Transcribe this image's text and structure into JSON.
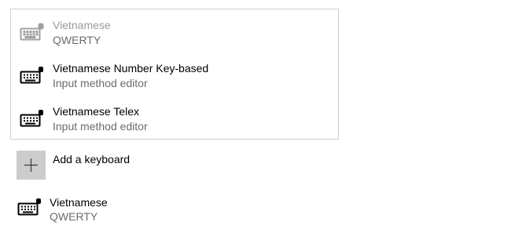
{
  "flyout": {
    "items": [
      {
        "title": "Vietnamese",
        "subtitle": "QWERTY",
        "icon": "keyboard-icon",
        "state": "disabled"
      },
      {
        "title": "Vietnamese Number Key-based",
        "subtitle": "Input method editor",
        "icon": "keyboard-icon",
        "state": "enabled"
      },
      {
        "title": "Vietnamese Telex",
        "subtitle": "Input method editor",
        "icon": "keyboard-icon",
        "state": "enabled"
      }
    ]
  },
  "add_keyboard": {
    "label": "Add a keyboard",
    "icon": "plus-icon"
  },
  "installed": {
    "title": "Vietnamese",
    "subtitle": "QWERTY",
    "icon": "keyboard-icon"
  },
  "colors": {
    "disabled_text": "#9a9a9a",
    "secondary_text": "#6b6b6b",
    "tile": "#cccccc",
    "border": "#cfcfcf"
  }
}
